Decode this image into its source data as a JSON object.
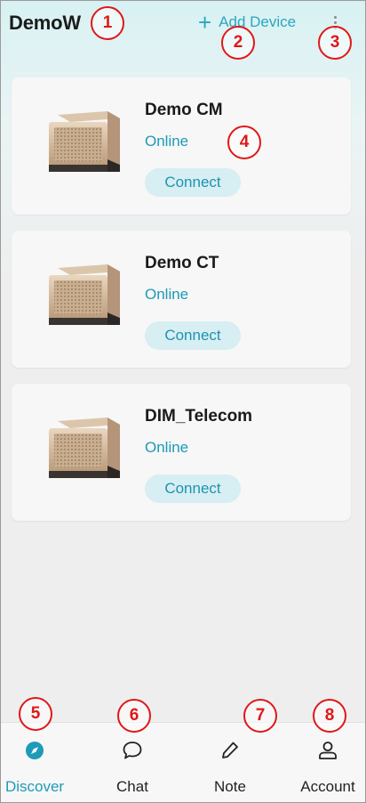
{
  "header": {
    "title": "DemoW",
    "add_device_label": "Add Device",
    "add_icon": "plus-icon",
    "more_icon": "more-vertical-icon"
  },
  "devices": [
    {
      "name": "Demo CM",
      "status": "Online",
      "action": "Connect"
    },
    {
      "name": "Demo CT",
      "status": "Online",
      "action": "Connect"
    },
    {
      "name": "DIM_Telecom",
      "status": "Online",
      "action": "Connect"
    }
  ],
  "bottom_nav": [
    {
      "label": "Discover",
      "icon": "compass-icon",
      "active": true
    },
    {
      "label": "Chat",
      "icon": "chat-bubble-icon",
      "active": false
    },
    {
      "label": "Note",
      "icon": "pencil-icon",
      "active": false
    },
    {
      "label": "Account",
      "icon": "person-icon",
      "active": false
    }
  ],
  "markers": [
    "1",
    "2",
    "3",
    "4",
    "5",
    "6",
    "7",
    "8"
  ],
  "colors": {
    "accent": "#1e9bb8",
    "marker": "#e01818",
    "connect_bg": "#d7eef3"
  }
}
